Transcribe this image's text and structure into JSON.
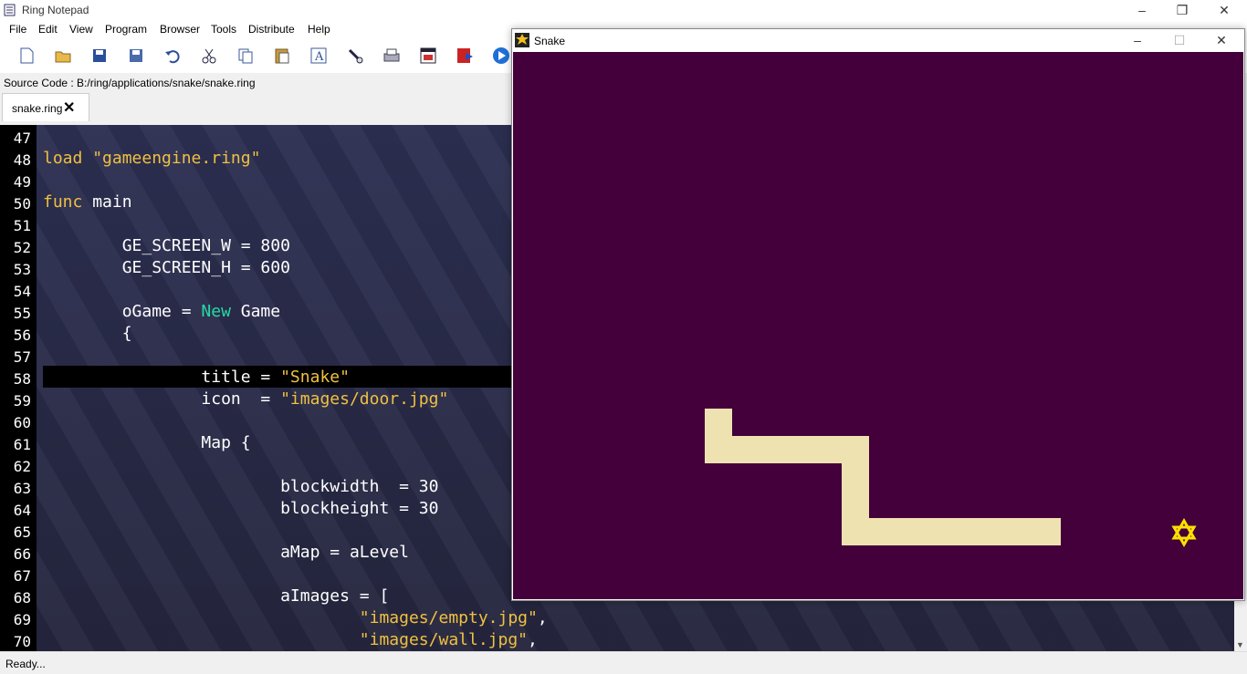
{
  "app": {
    "title": "Ring Notepad",
    "min": "–",
    "restore": "❐",
    "close": "✕"
  },
  "menu": [
    "File",
    "Edit",
    "View",
    "Program",
    "Browser",
    "Tools",
    "Distribute",
    "Help"
  ],
  "source": "Source Code : B:/ring/applications/snake/snake.ring",
  "tab": {
    "label": "snake.ring",
    "close": "✕"
  },
  "status": "Ready...",
  "lines": [
    {
      "n": "47",
      "code": []
    },
    {
      "n": "48",
      "code": [
        {
          "t": "load ",
          "c": "kw"
        },
        {
          "t": "\"gameengine.ring\"",
          "c": "str"
        }
      ]
    },
    {
      "n": "49",
      "code": []
    },
    {
      "n": "50",
      "code": [
        {
          "t": "func ",
          "c": "kw"
        },
        {
          "t": "main",
          "c": ""
        }
      ]
    },
    {
      "n": "51",
      "code": []
    },
    {
      "n": "52",
      "code": [
        {
          "t": "        GE_SCREEN_W = 800",
          "c": ""
        }
      ]
    },
    {
      "n": "53",
      "code": [
        {
          "t": "        GE_SCREEN_H = 600",
          "c": ""
        }
      ]
    },
    {
      "n": "54",
      "code": []
    },
    {
      "n": "55",
      "code": [
        {
          "t": "        oGame = ",
          "c": ""
        },
        {
          "t": "New",
          "c": "kw2"
        },
        {
          "t": " Game",
          "c": ""
        }
      ]
    },
    {
      "n": "56",
      "code": [
        {
          "t": "        {",
          "c": ""
        }
      ]
    },
    {
      "n": "57",
      "code": []
    },
    {
      "n": "58",
      "code": [
        {
          "t": "                title = ",
          "c": ""
        },
        {
          "t": "\"Snake\"",
          "c": "str"
        }
      ]
    },
    {
      "n": "59",
      "code": [
        {
          "t": "                icon  = ",
          "c": ""
        },
        {
          "t": "\"images/door.jpg\"",
          "c": "str"
        }
      ]
    },
    {
      "n": "60",
      "code": []
    },
    {
      "n": "61",
      "code": [
        {
          "t": "                Map {",
          "c": ""
        }
      ]
    },
    {
      "n": "62",
      "code": []
    },
    {
      "n": "63",
      "code": [
        {
          "t": "                        blockwidth  = 30",
          "c": ""
        }
      ]
    },
    {
      "n": "64",
      "code": [
        {
          "t": "                        blockheight = 30",
          "c": ""
        }
      ]
    },
    {
      "n": "65",
      "code": []
    },
    {
      "n": "66",
      "code": [
        {
          "t": "                        aMap = aLevel",
          "c": ""
        }
      ]
    },
    {
      "n": "67",
      "code": []
    },
    {
      "n": "68",
      "code": [
        {
          "t": "                        aImages = [",
          "c": ""
        }
      ]
    },
    {
      "n": "69",
      "code": [
        {
          "t": "                                ",
          "c": ""
        },
        {
          "t": "\"images/empty.jpg\"",
          "c": "str"
        },
        {
          "t": ",",
          "c": ""
        }
      ]
    },
    {
      "n": "70",
      "code": [
        {
          "t": "                                ",
          "c": ""
        },
        {
          "t": "\"images/wall.jpg\"",
          "c": "str"
        },
        {
          "t": ",",
          "c": ""
        }
      ]
    }
  ],
  "snake_window": {
    "title": "Snake",
    "min": "–",
    "max": "☐",
    "close": "✕",
    "background_color": "#43003a",
    "snake_color": "#efe2b1",
    "food_icon": "star-icon",
    "food_color": "#ffe000"
  },
  "toolbar_icons": [
    "new-file-icon",
    "open-folder-icon",
    "save-icon",
    "save-as-icon",
    "undo-icon",
    "cut-icon",
    "copy-icon",
    "paste-icon",
    "font-icon",
    "find-icon",
    "print-icon",
    "form-designer-icon",
    "debug-icon",
    "run-icon"
  ]
}
